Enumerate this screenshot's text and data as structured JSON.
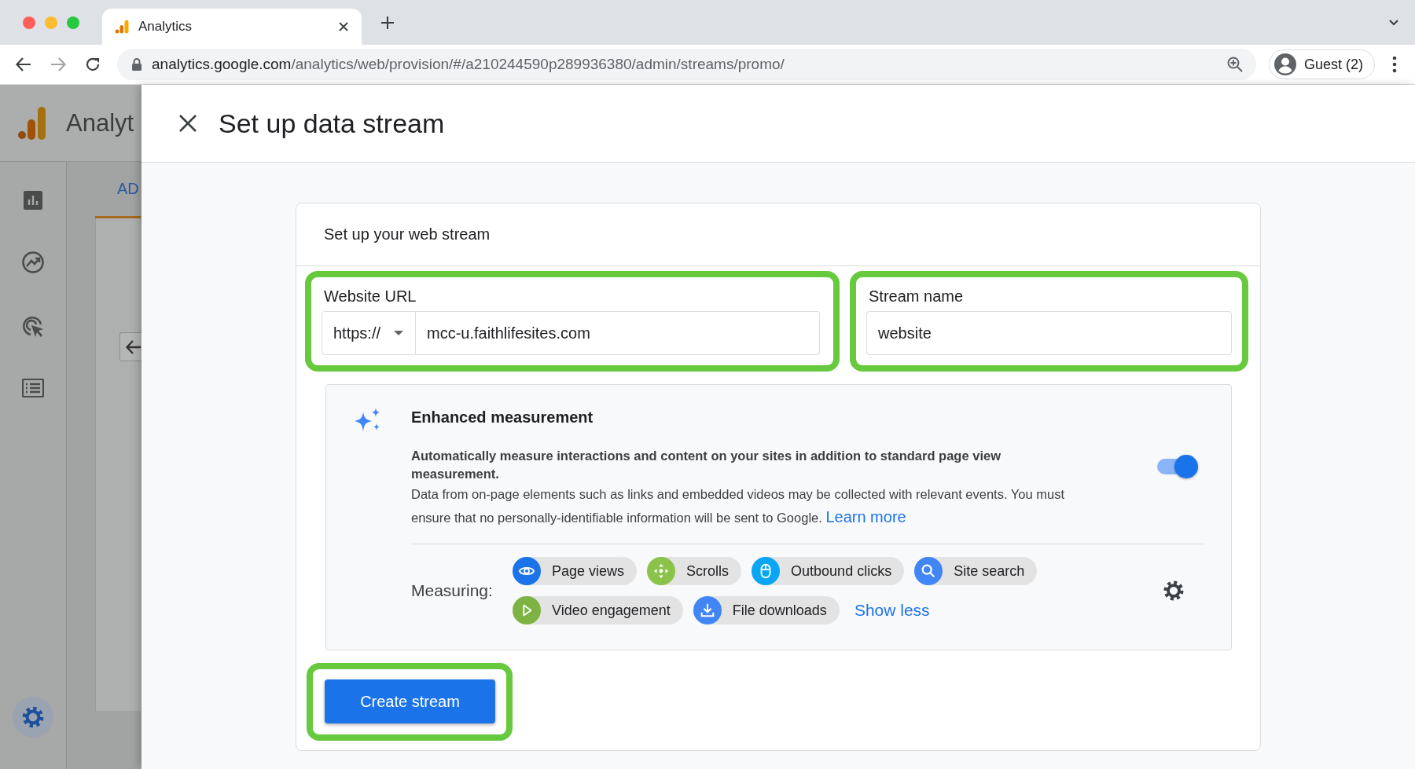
{
  "browser": {
    "tabs": [
      {
        "title": "Analytics",
        "selected": true
      }
    ],
    "url": {
      "host": "analytics.google.com",
      "path": "/analytics/web/provision/#/a210244590p289936380/admin/streams/promo/"
    },
    "profile": "Guest (2)"
  },
  "background": {
    "app_name": "Analyt",
    "tab_label": "AD"
  },
  "panel": {
    "title": "Set up data stream",
    "card_title": "Set up your web stream",
    "url_field": {
      "label": "Website URL",
      "protocol": "https://",
      "value": "mcc-u.faithlifesites.com",
      "highlighted": true
    },
    "name_field": {
      "label": "Stream name",
      "value": "website",
      "highlighted": true
    },
    "enhanced": {
      "title": "Enhanced measurement",
      "summary": "Automatically measure interactions and content on your sites in addition to standard page view measurement.",
      "note": "Data from on-page elements such as links and embedded videos may be collected with relevant events. You must ensure that no personally-identifiable information will be sent to Google.",
      "link": "Learn more",
      "on": true,
      "measuring_label": "Measuring:",
      "events": [
        {
          "label": "Page views",
          "kind": "eye",
          "color": "#1a73e8"
        },
        {
          "label": "Scrolls",
          "kind": "arrows",
          "color": "#8bc34a"
        },
        {
          "label": "Outbound clicks",
          "kind": "mouse",
          "color": "#0aa5f5"
        },
        {
          "label": "Site search",
          "kind": "search",
          "color": "#4285f4"
        },
        {
          "label": "Video engagement",
          "kind": "play",
          "color": "#7cb342"
        },
        {
          "label": "File downloads",
          "kind": "download",
          "color": "#4285f4"
        }
      ],
      "toggle_link": "Show less"
    },
    "create_button": {
      "label": "Create stream",
      "highlighted": true
    }
  }
}
